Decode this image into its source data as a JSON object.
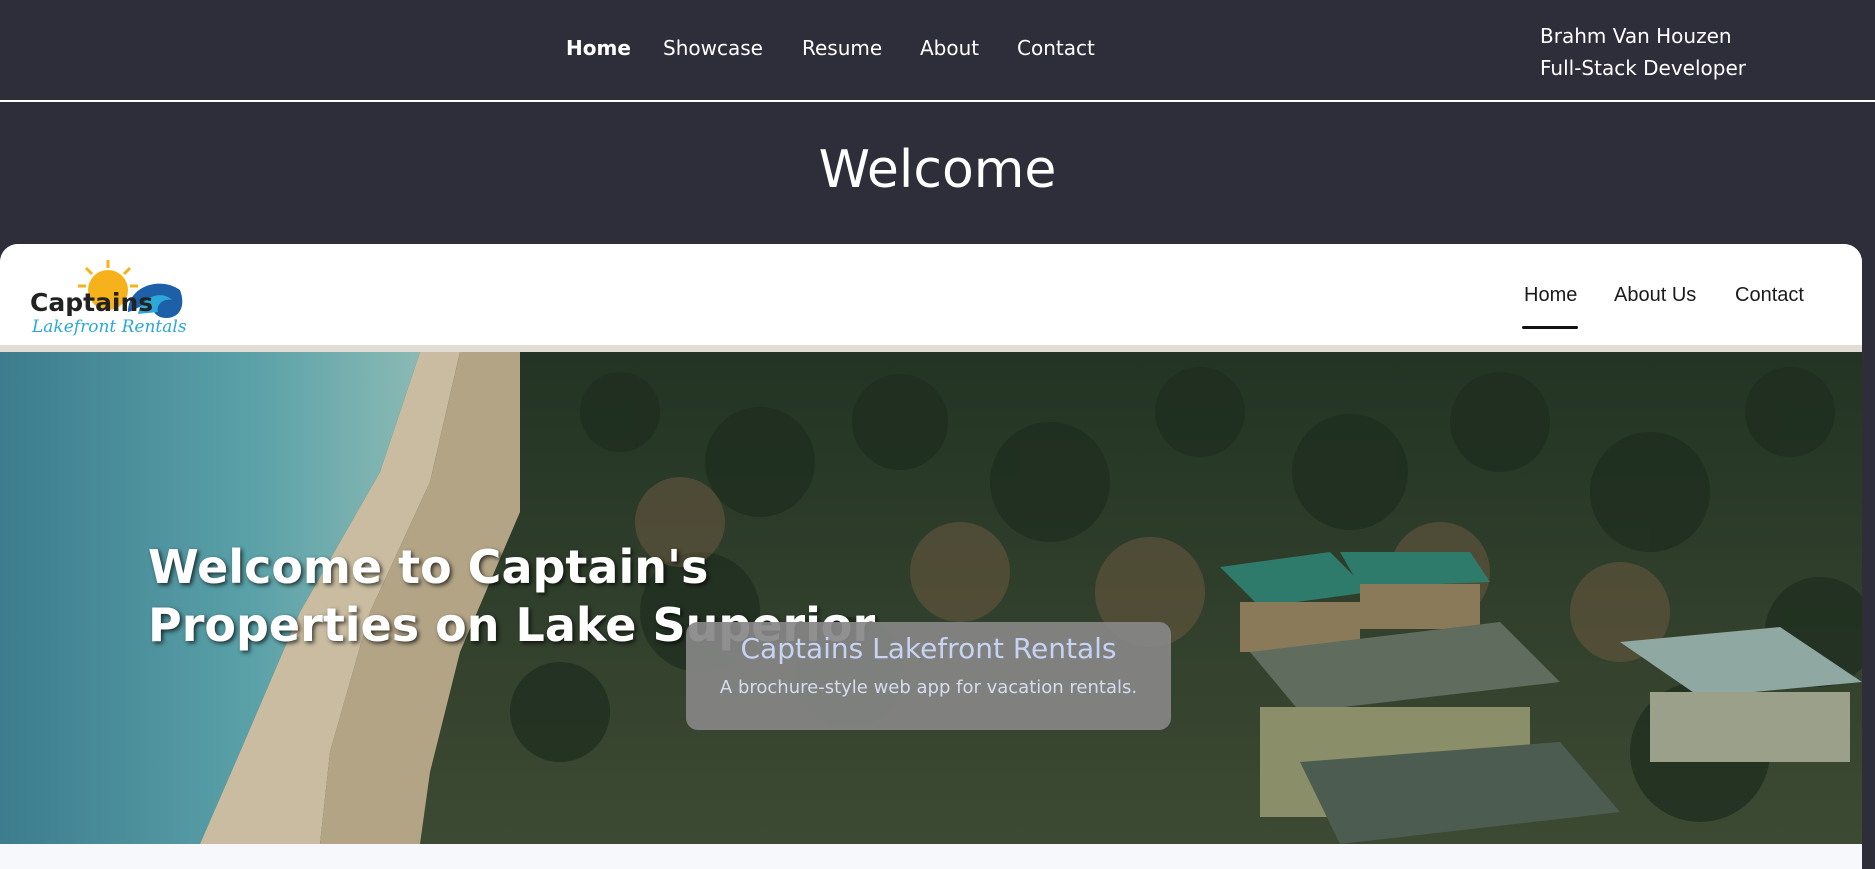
{
  "topnav": {
    "links": [
      "Home",
      "Showcase",
      "Resume",
      "About",
      "Contact"
    ],
    "author_name": "Brahm Van Houzen",
    "author_role": "Full-Stack Developer"
  },
  "page_title": "Welcome",
  "preview": {
    "logo": {
      "line1": "Captains",
      "line2": "Lakefront Rentals"
    },
    "nav": [
      "Home",
      "About Us",
      "Contact"
    ],
    "hero_title": "Welcome to Captain's Properties on Lake Superior",
    "card_title": "Captains Lakefront Rentals",
    "card_subtitle": "A brochure-style web app for vacation rentals."
  },
  "colors": {
    "background": "#2e2d3a",
    "header_divider": "#ffffff",
    "card_bg": "#878787",
    "card_title": "#c7d3f2",
    "logo_blue": "#2aa8d8"
  }
}
